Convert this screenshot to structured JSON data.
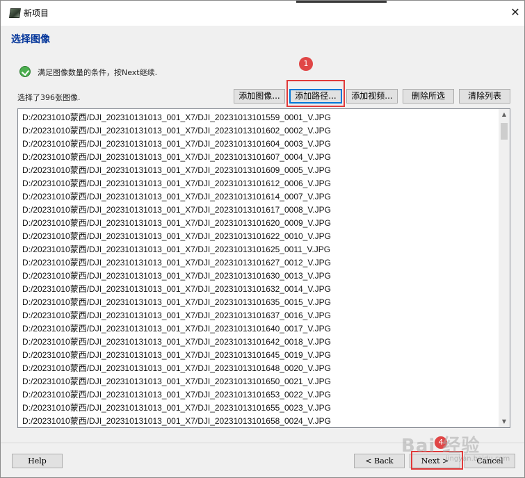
{
  "window": {
    "title": "新项目",
    "close_glyph": "✕"
  },
  "page": {
    "heading": "选择图像",
    "status_icon": "check-circle-icon",
    "status_text": "满足图像数量的条件，按Next继续.",
    "count_text": "选择了396张图像."
  },
  "toolbar": {
    "add_images": "添加图像...",
    "add_path": "添加路径...",
    "add_video": "添加视频...",
    "delete_selected": "删除所选",
    "clear_list": "清除列表"
  },
  "file_list": [
    "D:/20231010蒙西/DJI_202310131013_001_X7/DJI_20231013101559_0001_V.JPG",
    "D:/20231010蒙西/DJI_202310131013_001_X7/DJI_20231013101602_0002_V.JPG",
    "D:/20231010蒙西/DJI_202310131013_001_X7/DJI_20231013101604_0003_V.JPG",
    "D:/20231010蒙西/DJI_202310131013_001_X7/DJI_20231013101607_0004_V.JPG",
    "D:/20231010蒙西/DJI_202310131013_001_X7/DJI_20231013101609_0005_V.JPG",
    "D:/20231010蒙西/DJI_202310131013_001_X7/DJI_20231013101612_0006_V.JPG",
    "D:/20231010蒙西/DJI_202310131013_001_X7/DJI_20231013101614_0007_V.JPG",
    "D:/20231010蒙西/DJI_202310131013_001_X7/DJI_20231013101617_0008_V.JPG",
    "D:/20231010蒙西/DJI_202310131013_001_X7/DJI_20231013101620_0009_V.JPG",
    "D:/20231010蒙西/DJI_202310131013_001_X7/DJI_20231013101622_0010_V.JPG",
    "D:/20231010蒙西/DJI_202310131013_001_X7/DJI_20231013101625_0011_V.JPG",
    "D:/20231010蒙西/DJI_202310131013_001_X7/DJI_20231013101627_0012_V.JPG",
    "D:/20231010蒙西/DJI_202310131013_001_X7/DJI_20231013101630_0013_V.JPG",
    "D:/20231010蒙西/DJI_202310131013_001_X7/DJI_20231013101632_0014_V.JPG",
    "D:/20231010蒙西/DJI_202310131013_001_X7/DJI_20231013101635_0015_V.JPG",
    "D:/20231010蒙西/DJI_202310131013_001_X7/DJI_20231013101637_0016_V.JPG",
    "D:/20231010蒙西/DJI_202310131013_001_X7/DJI_20231013101640_0017_V.JPG",
    "D:/20231010蒙西/DJI_202310131013_001_X7/DJI_20231013101642_0018_V.JPG",
    "D:/20231010蒙西/DJI_202310131013_001_X7/DJI_20231013101645_0019_V.JPG",
    "D:/20231010蒙西/DJI_202310131013_001_X7/DJI_20231013101648_0020_V.JPG",
    "D:/20231010蒙西/DJI_202310131013_001_X7/DJI_20231013101650_0021_V.JPG",
    "D:/20231010蒙西/DJI_202310131013_001_X7/DJI_20231013101653_0022_V.JPG",
    "D:/20231010蒙西/DJI_202310131013_001_X7/DJI_20231013101655_0023_V.JPG",
    "D:/20231010蒙西/DJI_202310131013_001_X7/DJI_20231013101658_0024_V.JPG"
  ],
  "scrollbar": {
    "up_glyph": "▲",
    "down_glyph": "▼"
  },
  "footer": {
    "help": "Help",
    "back": "< Back",
    "next": "Next >",
    "cancel": "Cancel"
  },
  "annotations": {
    "step_one": "1",
    "step_two": "4"
  },
  "watermark": {
    "text": "Bai 经验",
    "sub": "jingyan.baidu.com"
  },
  "colors": {
    "heading": "#003399",
    "annotation": "#e03a3a"
  }
}
